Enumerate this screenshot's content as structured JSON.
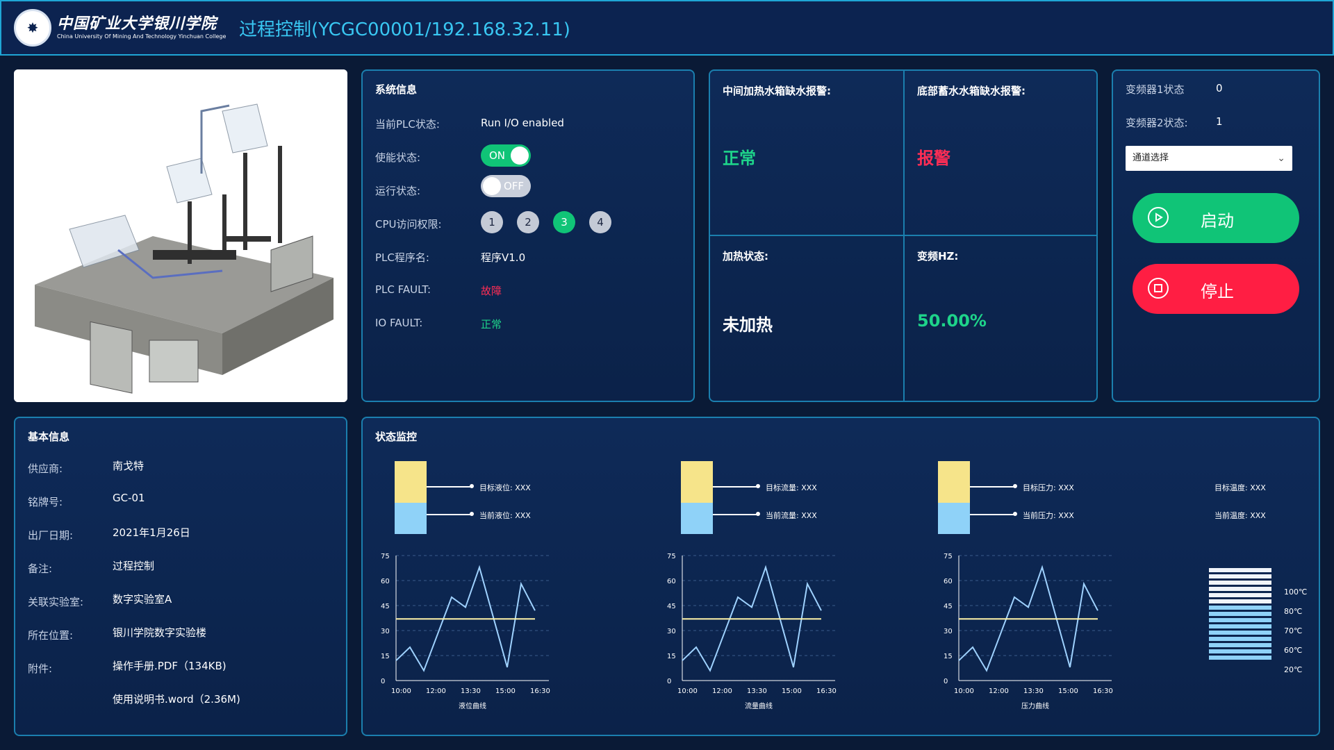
{
  "header": {
    "logo_cn": "中国矿业大学银川学院",
    "logo_en": "China University Of Mining And Technology Yinchuan College",
    "title": "过程控制(YCGC00001/192.168.32.11)"
  },
  "system_info": {
    "title": "系统信息",
    "plc_state_label": "当前PLC状态:",
    "plc_state_value": "Run I/O enabled",
    "enable_label": "使能状态:",
    "enable_toggle": "ON",
    "run_label": "运行状态:",
    "run_toggle": "OFF",
    "cpu_label": "CPU访问权限:",
    "cpu_levels": [
      "1",
      "2",
      "3",
      "4"
    ],
    "cpu_active_index": 2,
    "program_label": "PLC程序名:",
    "program_value": "程序V1.0",
    "plc_fault_label": "PLC FAULT:",
    "plc_fault_value": "故障",
    "io_fault_label": "IO FAULT:",
    "io_fault_value": "正常"
  },
  "alarms": {
    "mid_tank_label": "中间加热水箱缺水报警:",
    "mid_tank_value": "正常",
    "bottom_tank_label": "底部蓄水水箱缺水报警:",
    "bottom_tank_value": "报警",
    "heat_label": "加热状态:",
    "heat_value": "未加热",
    "freq_label": "变频HZ:",
    "freq_value": "50.00%"
  },
  "control": {
    "inverter1_label": "变频器1状态",
    "inverter1_value": "0",
    "inverter2_label": "变频器2状态:",
    "inverter2_value": "1",
    "channel_select": "通道选择",
    "start_label": "启动",
    "stop_label": "停止"
  },
  "basic_info": {
    "title": "基本信息",
    "supplier_label": "供应商:",
    "supplier_value": "南戈特",
    "nameplate_label": "铭牌号:",
    "nameplate_value": "GC-01",
    "date_label": "出厂日期:",
    "date_value": "2021年1月26日",
    "note_label": "备注:",
    "note_value": "过程控制",
    "lab_label": "关联实验室:",
    "lab_value": "数字实验室A",
    "location_label": "所在位置:",
    "location_value": "银川学院数字实验楼",
    "attach_label": "附件:",
    "attach_1": "操作手册.PDF（134KB)",
    "attach_2": "使用说明书.word（2.36M)"
  },
  "monitor": {
    "title": "状态监控",
    "level": {
      "target": "目标液位: XXX",
      "current": "当前液位: XXX",
      "caption": "液位曲线"
    },
    "flow": {
      "target": "目标流量: XXX",
      "current": "当前流量: XXX",
      "caption": "流量曲线"
    },
    "pressure": {
      "target": "目标压力: XXX",
      "current": "当前压力: XXX",
      "caption": "压力曲线"
    },
    "temp": {
      "target": "目标温度: XXX",
      "current": "当前温度: XXX",
      "ticks": [
        "100℃",
        "80℃",
        "70℃",
        "60℃",
        "20℃"
      ]
    }
  },
  "colors": {
    "green": "#10c477",
    "red": "#ff2d55",
    "accent": "#39c7f2"
  },
  "chart_data": [
    {
      "type": "line",
      "caption": "液位曲线",
      "x": [
        "10:00",
        "12:00",
        "13:30",
        "15:00",
        "16:30"
      ],
      "y_ticks": [
        0,
        15,
        30,
        45,
        60,
        75
      ],
      "ylim": [
        0,
        75
      ],
      "series": [
        {
          "values": [
            12,
            20,
            6,
            28,
            50,
            44,
            68,
            38,
            8,
            58,
            42
          ]
        },
        {
          "values": [
            37,
            37,
            37,
            37,
            37,
            37,
            37,
            37,
            37,
            37,
            37
          ]
        }
      ]
    },
    {
      "type": "line",
      "caption": "流量曲线",
      "x": [
        "10:00",
        "12:00",
        "13:30",
        "15:00",
        "16:30"
      ],
      "y_ticks": [
        0,
        15,
        30,
        45,
        60,
        75
      ],
      "ylim": [
        0,
        75
      ],
      "series": [
        {
          "values": [
            12,
            20,
            6,
            28,
            50,
            44,
            68,
            38,
            8,
            58,
            42
          ]
        },
        {
          "values": [
            37,
            37,
            37,
            37,
            37,
            37,
            37,
            37,
            37,
            37,
            37
          ]
        }
      ]
    },
    {
      "type": "line",
      "caption": "压力曲线",
      "x": [
        "10:00",
        "12:00",
        "13:30",
        "15:00",
        "16:30"
      ],
      "y_ticks": [
        0,
        15,
        30,
        45,
        60,
        75
      ],
      "ylim": [
        0,
        75
      ],
      "series": [
        {
          "values": [
            12,
            20,
            6,
            28,
            50,
            44,
            68,
            38,
            8,
            58,
            42
          ]
        },
        {
          "values": [
            37,
            37,
            37,
            37,
            37,
            37,
            37,
            37,
            37,
            37,
            37
          ]
        }
      ]
    }
  ]
}
